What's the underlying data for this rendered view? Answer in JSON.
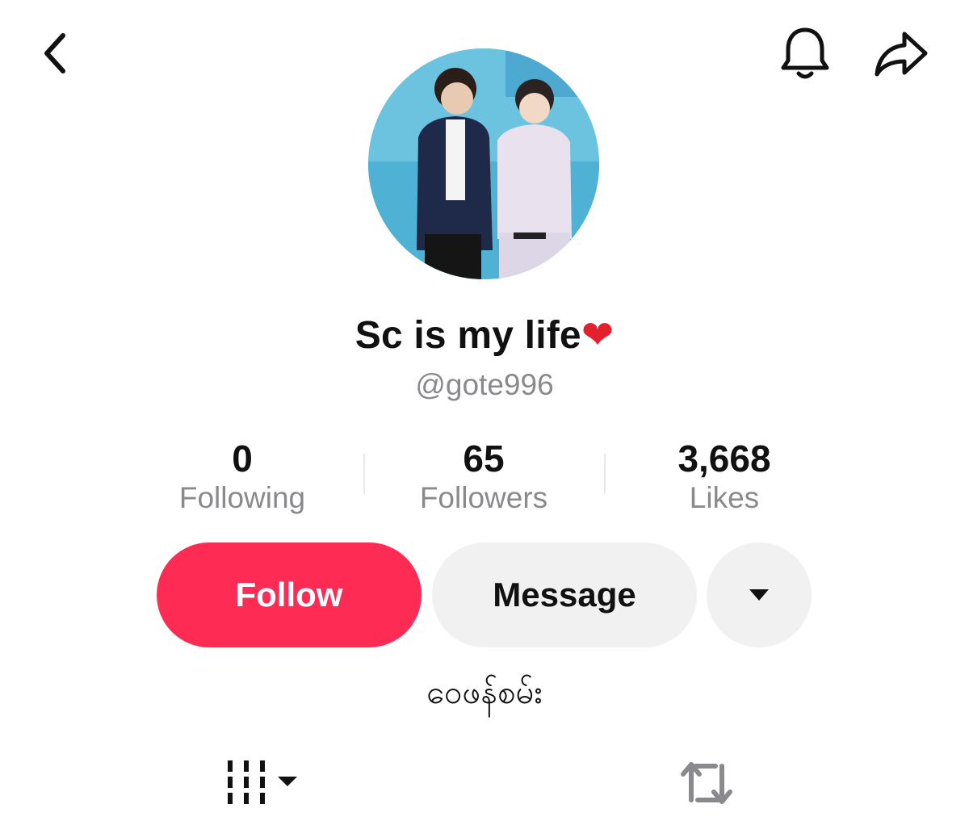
{
  "header": {
    "back_icon": "chevron-left-icon",
    "bell_icon": "bell-icon",
    "share_icon": "share-arrow-icon"
  },
  "profile": {
    "display_name": "Sc is my life",
    "name_emoji": "❤",
    "handle": "@gote996",
    "bio": "ဝေဖန်စမ်း"
  },
  "stats": [
    {
      "value": "0",
      "label": "Following"
    },
    {
      "value": "65",
      "label": "Followers"
    },
    {
      "value": "3,668",
      "label": "Likes"
    }
  ],
  "actions": {
    "follow_label": "Follow",
    "message_label": "Message",
    "more_icon": "triangle-down-icon"
  },
  "tabs": [
    {
      "icon": "grid-videos-icon"
    },
    {
      "icon": "repost-icon"
    }
  ],
  "colors": {
    "accent": "#fe2c55",
    "muted_text": "#8a8a8e",
    "button_bg": "#f1f1f2"
  }
}
